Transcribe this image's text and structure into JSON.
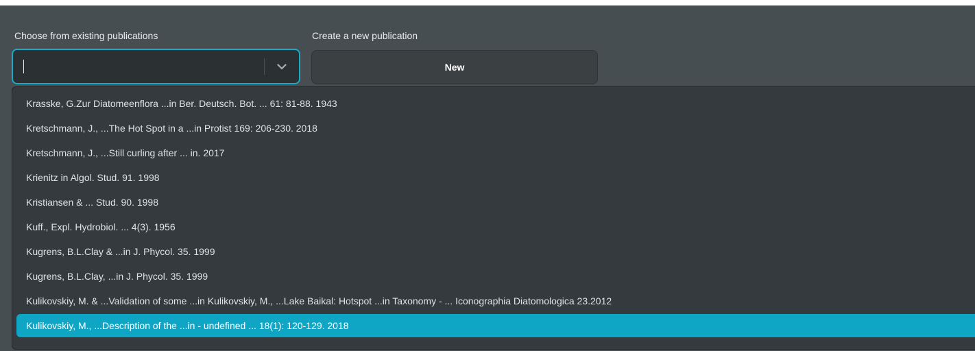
{
  "existing": {
    "label": "Choose from existing publications",
    "value": ""
  },
  "create": {
    "label": "Create a new publication",
    "button_label": "New"
  },
  "dropdown": {
    "options": [
      "Krasske, G.Zur Diatomeenflora ...in Ber. Deutsch. Bot. ... 61: 81-88. 1943",
      "Kretschmann, J., ...The Hot Spot in a ...in Protist 169: 206-230. 2018",
      "Kretschmann, J., ...Still curling after ... in. 2017",
      "Krienitz in Algol. Stud. 91. 1998",
      "Kristiansen & ... Stud. 90. 1998",
      "Kuff., Expl. Hydrobiol. ... 4(3). 1956",
      "Kugrens, B.L.Clay & ...in J. Phycol. 35. 1999",
      "Kugrens, B.L.Clay, ...in J. Phycol. 35. 1999",
      "Kulikovskiy, M. & ...Validation of some ...in Kulikovskiy, M., ...Lake Baikal: Hotspot ...in Taxonomy - ... Iconographia Diatomologica 23.2012",
      "Kulikovskiy, M., ...Description of the ...in - undefined ... 18(1): 120-129. 2018"
    ],
    "selected_index": 9
  },
  "colors": {
    "panel": "#474e51",
    "accent": "#19a9c9",
    "selected": "#0fa5c5"
  },
  "icons": {
    "dropdown_toggle": "chevron-down-icon"
  }
}
